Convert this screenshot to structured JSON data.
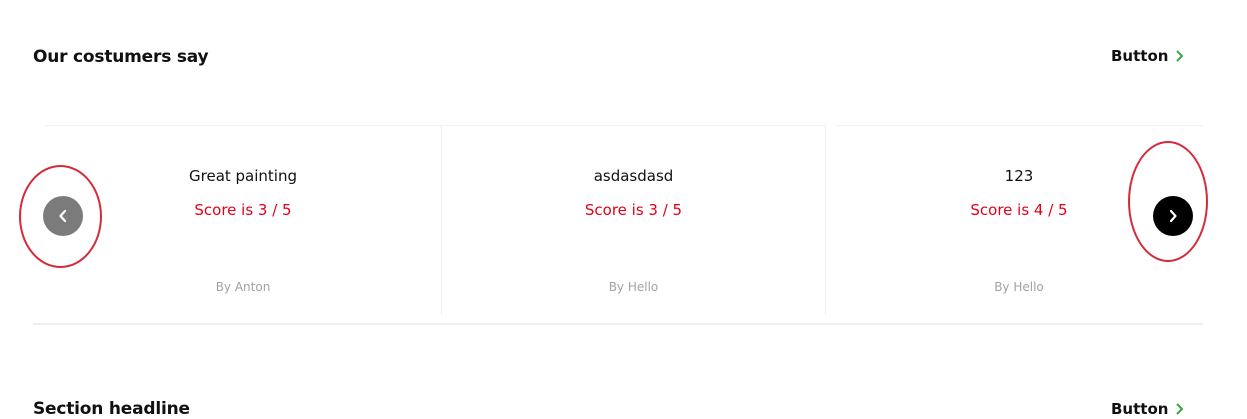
{
  "testimonials_section": {
    "title": "Our costumers say",
    "button_label": "Button",
    "cards": [
      {
        "title": "Great painting",
        "score_text": "Score is 3 / 5",
        "author": "By Anton"
      },
      {
        "title": "asdasdasd",
        "score_text": "Score is 3 / 5",
        "author": "By Hello"
      },
      {
        "title": "123",
        "score_text": "Score is 4 / 5",
        "author": "By Hello"
      }
    ],
    "prev_icon": "chevron-left-icon",
    "next_icon": "chevron-right-icon"
  },
  "next_section": {
    "title": "Section headline",
    "button_label": "Button"
  },
  "colors": {
    "score": "#e00018",
    "button_chevron": "#3aa64a",
    "annotation": "#d42a3a",
    "prev_button": "#7b7b7b",
    "next_button": "#000000"
  }
}
